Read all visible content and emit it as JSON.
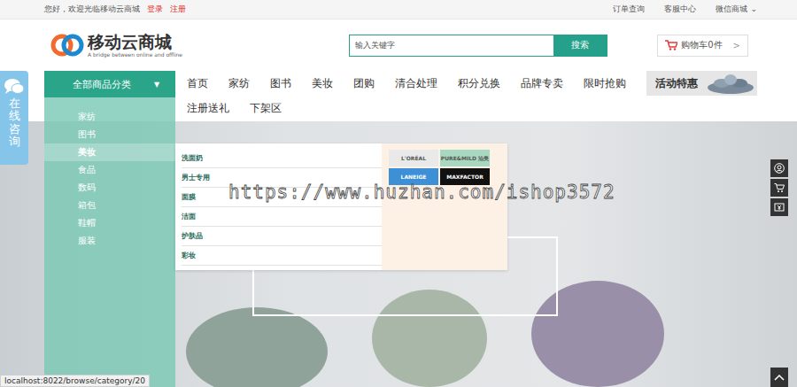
{
  "topbar": {
    "greeting": "您好，欢迎光临移动云商城",
    "login": "登录",
    "register": "注册",
    "links": [
      "订单查询",
      "客服中心",
      "微信商城"
    ],
    "dropdown_icon": "⌄"
  },
  "logo": {
    "name": "移动云商城",
    "tagline": "A bridge between online and offline"
  },
  "search": {
    "placeholder": "输入关键字",
    "button": "搜索"
  },
  "cart": {
    "label": "购物车0件",
    "arrow": ">"
  },
  "category_button": {
    "label": "全部商品分类",
    "arrow": "▼"
  },
  "nav": [
    {
      "label": "首页"
    },
    {
      "label": "家纺"
    },
    {
      "label": "图书"
    },
    {
      "label": "美妆"
    },
    {
      "label": "团购"
    },
    {
      "label": "清合处理"
    },
    {
      "label": "积分兑换"
    },
    {
      "label": "品牌专卖"
    },
    {
      "label": "限时抢购"
    },
    {
      "label": "注册送礼"
    },
    {
      "label": "下架区"
    }
  ],
  "promo": {
    "label": "活动特惠"
  },
  "categories": [
    {
      "label": "家纺",
      "selected": false
    },
    {
      "label": "图书",
      "selected": false
    },
    {
      "label": "美妆",
      "selected": true
    },
    {
      "label": "食品",
      "selected": false
    },
    {
      "label": "数码",
      "selected": false
    },
    {
      "label": "箱包",
      "selected": false
    },
    {
      "label": "鞋帽",
      "selected": false
    },
    {
      "label": "服装",
      "selected": false
    }
  ],
  "submenu": {
    "items": [
      "洗面奶",
      "男士专用",
      "面膜",
      "洁面",
      "护肤品",
      "彩妆"
    ],
    "brands": [
      {
        "label": "L'ORÉAL",
        "color": "#e9e9e9"
      },
      {
        "label": "PURE&MILD 泊美",
        "color": "#a8d8c0"
      },
      {
        "label": "LANEIGE",
        "color": "#3d8fd6"
      },
      {
        "label": "MAXFACTOR",
        "color": "#111111"
      }
    ]
  },
  "consult": {
    "label": "在线咨询"
  },
  "watermark": "https://www.huzhan.com/ishop3572",
  "status_bar": "localhost:8022/browse/category/20"
}
